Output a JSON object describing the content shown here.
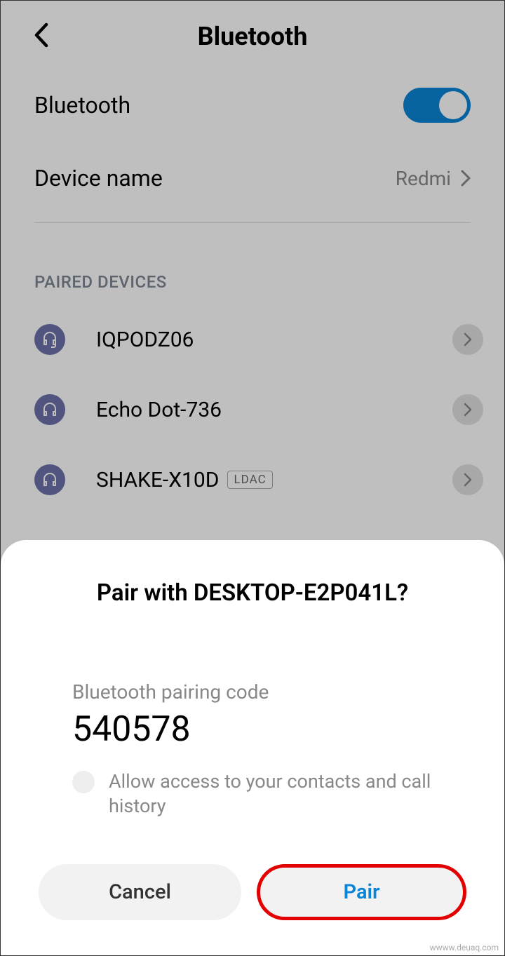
{
  "header": {
    "title": "Bluetooth"
  },
  "settings": {
    "bluetooth_label": "Bluetooth",
    "bluetooth_enabled": true,
    "device_name_label": "Device name",
    "device_name_value": "Redmi"
  },
  "paired_section": {
    "title": "PAIRED DEVICES",
    "devices": [
      {
        "name": "IQPODZ06",
        "icon": "headset",
        "badge": null
      },
      {
        "name": "Echo Dot-736",
        "icon": "headphones",
        "badge": null
      },
      {
        "name": "SHAKE-X10D",
        "icon": "headphones",
        "badge": "LDAC"
      }
    ]
  },
  "modal": {
    "title": "Pair with DESKTOP-E2P041L?",
    "code_label": "Bluetooth pairing code",
    "code_value": "540578",
    "checkbox_label": "Allow access to your contacts and call history",
    "cancel_label": "Cancel",
    "pair_label": "Pair"
  },
  "watermark": "wwww.deuaq.com"
}
